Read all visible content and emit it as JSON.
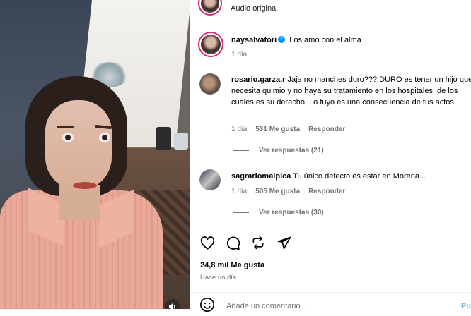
{
  "header": {
    "audio_label": "Audio original"
  },
  "caption": {
    "username": "naysalvatori",
    "text": "Los amo con el alma",
    "time": "1 día"
  },
  "comments": [
    {
      "username": "rosario.garza.r",
      "text": "Jaja no manches duro??? DURO es tener un hijo que necesita quimio y no haya su tratamiento en los hospitales. de los cuales es su derecho. Lo tuyo es una consecuencia de tus actos.",
      "time": "1 día",
      "likes": "531 Me gusta",
      "reply": "Responder",
      "view_replies": "Ver respuestas (21)"
    },
    {
      "username": "sagrariomalpica",
      "text": "Tu único defecto es estar en Morena...",
      "time": "1 día",
      "likes": "505 Me gusta",
      "reply": "Responder",
      "view_replies": "Ver respuestas (30)"
    }
  ],
  "footer": {
    "likes_count": "24,8 mil Me gusta",
    "posted_time": "Hace un día",
    "comment_placeholder": "Añade un comentario...",
    "post_label": "Pu"
  },
  "icons": {
    "like": "heart-icon",
    "comment": "comment-bubble-icon",
    "share": "repost-icon",
    "send": "send-icon",
    "emoji": "emoji-icon",
    "audio": "speaker-icon"
  },
  "colors": {
    "verified": "#0095f6",
    "meta_gray": "#737373",
    "story_ring": "#d62976",
    "post_link": "#78b4f5"
  }
}
